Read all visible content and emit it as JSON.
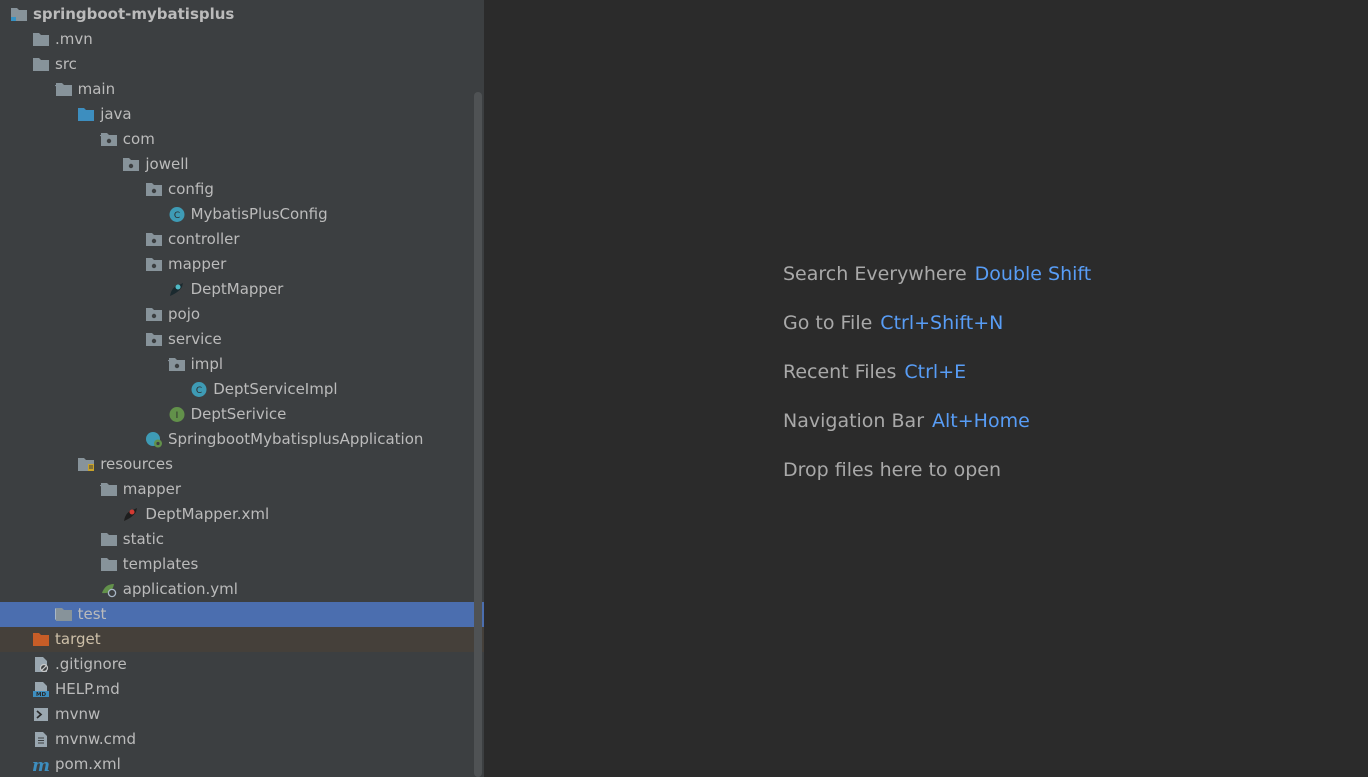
{
  "project_tree": {
    "rows": [
      {
        "label": "springboot-mybatisplus",
        "arrow": "none",
        "icon": "module-folder-icon",
        "root": true
      },
      {
        "label": ".mvn",
        "arrow": "collapsed",
        "icon": "folder-icon"
      },
      {
        "label": "src",
        "arrow": "expanded",
        "icon": "folder-icon"
      },
      {
        "label": "main",
        "arrow": "expanded",
        "icon": "folder-icon"
      },
      {
        "label": "java",
        "arrow": "expanded",
        "icon": "source-folder-icon"
      },
      {
        "label": "com",
        "arrow": "expanded",
        "icon": "package-icon"
      },
      {
        "label": "jowell",
        "arrow": "expanded",
        "icon": "package-icon"
      },
      {
        "label": "config",
        "arrow": "expanded",
        "icon": "package-icon"
      },
      {
        "label": "MybatisPlusConfig",
        "arrow": "none",
        "icon": "java-class-icon"
      },
      {
        "label": "controller",
        "arrow": "collapsed",
        "icon": "package-icon"
      },
      {
        "label": "mapper",
        "arrow": "expanded",
        "icon": "package-icon"
      },
      {
        "label": "DeptMapper",
        "arrow": "none",
        "icon": "mybatis-mapper-icon"
      },
      {
        "label": "pojo",
        "arrow": "collapsed",
        "icon": "package-icon"
      },
      {
        "label": "service",
        "arrow": "expanded",
        "icon": "package-icon"
      },
      {
        "label": "impl",
        "arrow": "expanded",
        "icon": "package-icon"
      },
      {
        "label": "DeptServiceImpl",
        "arrow": "none",
        "icon": "java-class-icon"
      },
      {
        "label": "DeptSerivice",
        "arrow": "none",
        "icon": "java-interface-icon"
      },
      {
        "label": "SpringbootMybatisplusApplication",
        "arrow": "none",
        "icon": "spring-boot-class-icon"
      },
      {
        "label": "resources",
        "arrow": "expanded",
        "icon": "resources-folder-icon"
      },
      {
        "label": "mapper",
        "arrow": "expanded",
        "icon": "folder-icon"
      },
      {
        "label": "DeptMapper.xml",
        "arrow": "none",
        "icon": "mybatis-xml-icon"
      },
      {
        "label": "static",
        "arrow": "none",
        "icon": "folder-icon"
      },
      {
        "label": "templates",
        "arrow": "none",
        "icon": "folder-icon"
      },
      {
        "label": "application.yml",
        "arrow": "none",
        "icon": "spring-config-icon"
      },
      {
        "label": "test",
        "arrow": "collapsed",
        "icon": "folder-icon",
        "selected": true
      },
      {
        "label": "target",
        "arrow": "collapsed",
        "icon": "excluded-folder-icon",
        "excluded": true
      },
      {
        "label": ".gitignore",
        "arrow": "none",
        "icon": "ignore-file-icon"
      },
      {
        "label": "HELP.md",
        "arrow": "none",
        "icon": "markdown-file-icon"
      },
      {
        "label": "mvnw",
        "arrow": "none",
        "icon": "shell-script-icon"
      },
      {
        "label": "mvnw.cmd",
        "arrow": "none",
        "icon": "text-file-icon"
      },
      {
        "label": "pom.xml",
        "arrow": "none",
        "icon": "maven-icon"
      }
    ]
  },
  "editor_hints": [
    {
      "label": "Search Everywhere",
      "shortcut": "Double Shift"
    },
    {
      "label": "Go to File",
      "shortcut": "Ctrl+Shift+N"
    },
    {
      "label": "Recent Files",
      "shortcut": "Ctrl+E"
    },
    {
      "label": "Navigation Bar",
      "shortcut": "Alt+Home"
    },
    {
      "label": "Drop files here to open",
      "shortcut": ""
    }
  ],
  "colors": {
    "panel_bg": "#3c3f41",
    "editor_bg": "#2b2b2b",
    "selection": "#4b6eaf",
    "excluded_row": "#45403a",
    "shortcut": "#589df6"
  }
}
